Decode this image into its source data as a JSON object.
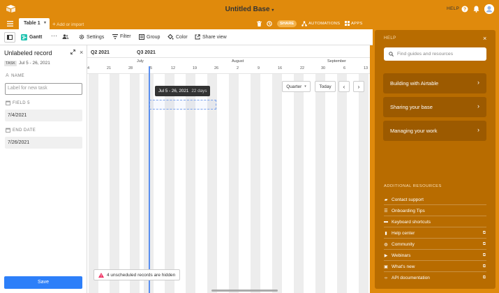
{
  "app": {
    "base_title": "Untitled Base",
    "help_label": "HELP",
    "share_label": "SHARE",
    "automations_label": "AUTOMATIONS",
    "apps_label": "APPS"
  },
  "tables": {
    "active": "Table 1",
    "add_import_label": "Add or import"
  },
  "viewbar": {
    "view_name": "Gantt",
    "settings_label": "Settings",
    "filter_label": "Filter",
    "group_label": "Group",
    "color_label": "Color",
    "share_view_label": "Share view"
  },
  "record": {
    "title": "Unlabeled record",
    "badge": "TASK",
    "dates": "Jul 5 - 26, 2021",
    "fields": [
      {
        "label": "NAME",
        "icon": "text-icon"
      },
      {
        "label": "FIELD 5",
        "value": "7/4/2021",
        "icon": "calendar-icon"
      },
      {
        "label": "END DATE",
        "value": "7/26/2021",
        "icon": "calendar-icon"
      }
    ],
    "name_placeholder": "Label for new task",
    "save_label": "Save"
  },
  "gantt": {
    "quarters": [
      "Q2 2021",
      "Q3 2021"
    ],
    "months": [
      "July",
      "August",
      "September"
    ],
    "days": [
      "4",
      "21",
      "28",
      "5",
      "12",
      "19",
      "26",
      "2",
      "9",
      "16",
      "22",
      "30",
      "6",
      "13"
    ],
    "tooltip_dates": "Jul 5 - 26, 2021",
    "tooltip_duration": "22 days",
    "zoom_label": "Quarter",
    "today_label": "Today",
    "unscheduled_label": "4 unscheduled records are hidden"
  },
  "help": {
    "title": "HELP",
    "search_placeholder": "Find guides and resources",
    "cards": [
      "Building with Airtable",
      "Sharing your base",
      "Managing your work"
    ],
    "resources_heading": "ADDITIONAL RESOURCES",
    "resources": [
      {
        "label": "Contact support",
        "icon": "chat-icon",
        "external": false
      },
      {
        "label": "Onboarding Tips",
        "icon": "list-icon",
        "external": false
      },
      {
        "label": "Keyboard shortcuts",
        "icon": "keyboard-icon",
        "external": false
      },
      {
        "label": "Help center",
        "icon": "book-icon",
        "external": true
      },
      {
        "label": "Community",
        "icon": "globe-icon",
        "external": true
      },
      {
        "label": "Webinars",
        "icon": "video-icon",
        "external": true
      },
      {
        "label": "What's new",
        "icon": "gift-icon",
        "external": true
      },
      {
        "label": "API documentation",
        "icon": "code-icon",
        "external": true
      }
    ]
  },
  "colors": {
    "brand_orange": "#e08a0c",
    "help_panel": "#b86c00",
    "help_card": "#9c5a00",
    "primary_blue": "#2d7ff9",
    "warning_red": "#ef3061"
  }
}
